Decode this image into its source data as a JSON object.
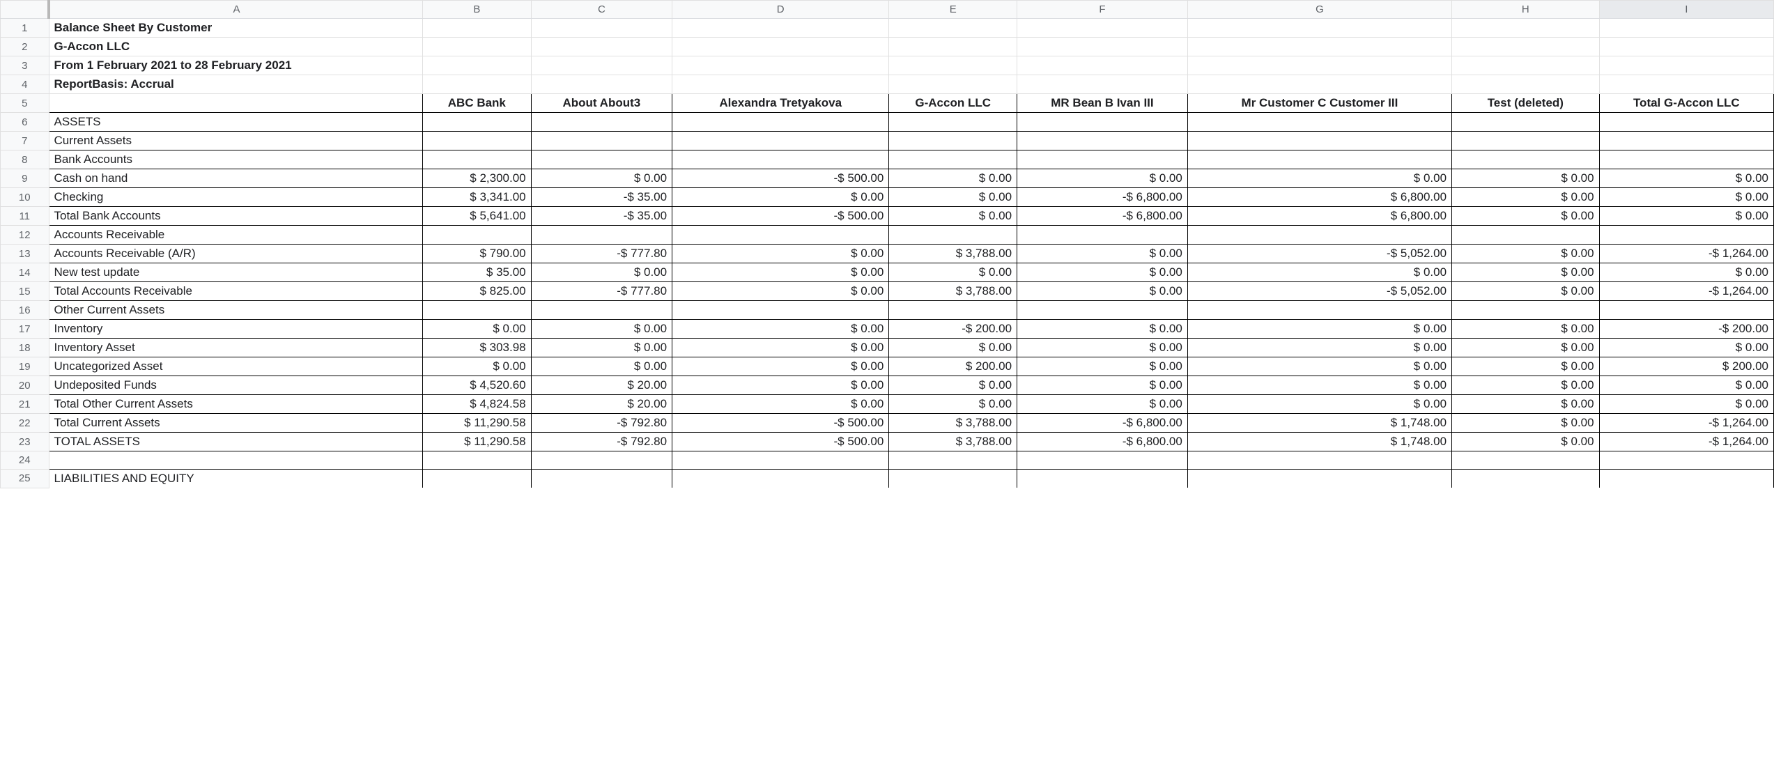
{
  "col_headers": [
    "A",
    "B",
    "C",
    "D",
    "E",
    "F",
    "G",
    "H",
    "I"
  ],
  "row_numbers": [
    1,
    2,
    3,
    4,
    5,
    6,
    7,
    8,
    9,
    10,
    11,
    12,
    13,
    14,
    15,
    16,
    17,
    18,
    19,
    20,
    21,
    22,
    23,
    24,
    25
  ],
  "title_rows": {
    "r1": "Balance Sheet By Customer",
    "r2": "G-Accon LLC",
    "r3": "From 1 February 2021 to 28 February 2021",
    "r4": "ReportBasis: Accrual"
  },
  "table_headers": {
    "A": "",
    "B": "ABC Bank",
    "C": "About About3",
    "D": "Alexandra Tretyakova",
    "E": "G-Accon LLC",
    "F": "MR Bean B Ivan III",
    "G": "Mr Customer C Customer III",
    "H": "Test (deleted)",
    "I": "Total G-Accon LLC"
  },
  "rows": {
    "r6": {
      "A": "ASSETS"
    },
    "r7": {
      "A": "Current Assets"
    },
    "r8": {
      "A": "Bank Accounts"
    },
    "r9": {
      "A": "Cash on hand",
      "B": "$ 2,300.00",
      "C": "$ 0.00",
      "D": "-$ 500.00",
      "E": "$ 0.00",
      "F": "$ 0.00",
      "G": "$ 0.00",
      "H": "$ 0.00",
      "I": "$ 0.00"
    },
    "r10": {
      "A": "Checking",
      "B": "$ 3,341.00",
      "C": "-$ 35.00",
      "D": "$ 0.00",
      "E": "$ 0.00",
      "F": "-$ 6,800.00",
      "G": "$ 6,800.00",
      "H": "$ 0.00",
      "I": "$ 0.00"
    },
    "r11": {
      "A": "Total Bank Accounts",
      "B": "$ 5,641.00",
      "C": "-$ 35.00",
      "D": "-$ 500.00",
      "E": "$ 0.00",
      "F": "-$ 6,800.00",
      "G": "$ 6,800.00",
      "H": "$ 0.00",
      "I": "$ 0.00"
    },
    "r12": {
      "A": "Accounts Receivable"
    },
    "r13": {
      "A": "Accounts Receivable (A/R)",
      "B": "$ 790.00",
      "C": "-$ 777.80",
      "D": "$ 0.00",
      "E": "$ 3,788.00",
      "F": "$ 0.00",
      "G": "-$ 5,052.00",
      "H": "$ 0.00",
      "I": "-$ 1,264.00"
    },
    "r14": {
      "A": "New test update",
      "B": "$ 35.00",
      "C": "$ 0.00",
      "D": "$ 0.00",
      "E": "$ 0.00",
      "F": "$ 0.00",
      "G": "$ 0.00",
      "H": "$ 0.00",
      "I": "$ 0.00"
    },
    "r15": {
      "A": "Total Accounts Receivable",
      "B": "$ 825.00",
      "C": "-$ 777.80",
      "D": "$ 0.00",
      "E": "$ 3,788.00",
      "F": "$ 0.00",
      "G": "-$ 5,052.00",
      "H": "$ 0.00",
      "I": "-$ 1,264.00"
    },
    "r16": {
      "A": "Other Current Assets"
    },
    "r17": {
      "A": "Inventory",
      "B": "$ 0.00",
      "C": "$ 0.00",
      "D": "$ 0.00",
      "E": "-$ 200.00",
      "F": "$ 0.00",
      "G": "$ 0.00",
      "H": "$ 0.00",
      "I": "-$ 200.00"
    },
    "r18": {
      "A": "Inventory Asset",
      "B": "$ 303.98",
      "C": "$ 0.00",
      "D": "$ 0.00",
      "E": "$ 0.00",
      "F": "$ 0.00",
      "G": "$ 0.00",
      "H": "$ 0.00",
      "I": "$ 0.00"
    },
    "r19": {
      "A": "Uncategorized Asset",
      "B": "$ 0.00",
      "C": "$ 0.00",
      "D": "$ 0.00",
      "E": "$ 200.00",
      "F": "$ 0.00",
      "G": "$ 0.00",
      "H": "$ 0.00",
      "I": "$ 200.00"
    },
    "r20": {
      "A": "Undeposited Funds",
      "B": "$ 4,520.60",
      "C": "$ 20.00",
      "D": "$ 0.00",
      "E": "$ 0.00",
      "F": "$ 0.00",
      "G": "$ 0.00",
      "H": "$ 0.00",
      "I": "$ 0.00"
    },
    "r21": {
      "A": "Total Other Current Assets",
      "B": "$ 4,824.58",
      "C": "$ 20.00",
      "D": "$ 0.00",
      "E": "$ 0.00",
      "F": "$ 0.00",
      "G": "$ 0.00",
      "H": "$ 0.00",
      "I": "$ 0.00"
    },
    "r22": {
      "A": "Total Current Assets",
      "B": "$ 11,290.58",
      "C": "-$ 792.80",
      "D": "-$ 500.00",
      "E": "$ 3,788.00",
      "F": "-$ 6,800.00",
      "G": "$ 1,748.00",
      "H": "$ 0.00",
      "I": "-$ 1,264.00"
    },
    "r23": {
      "A": "TOTAL ASSETS",
      "B": "$ 11,290.58",
      "C": "-$ 792.80",
      "D": "-$ 500.00",
      "E": "$ 3,788.00",
      "F": "-$ 6,800.00",
      "G": "$ 1,748.00",
      "H": "$ 0.00",
      "I": "-$ 1,264.00"
    },
    "r24": {
      "A": ""
    },
    "r25": {
      "A": "LIABILITIES AND EQUITY"
    }
  }
}
